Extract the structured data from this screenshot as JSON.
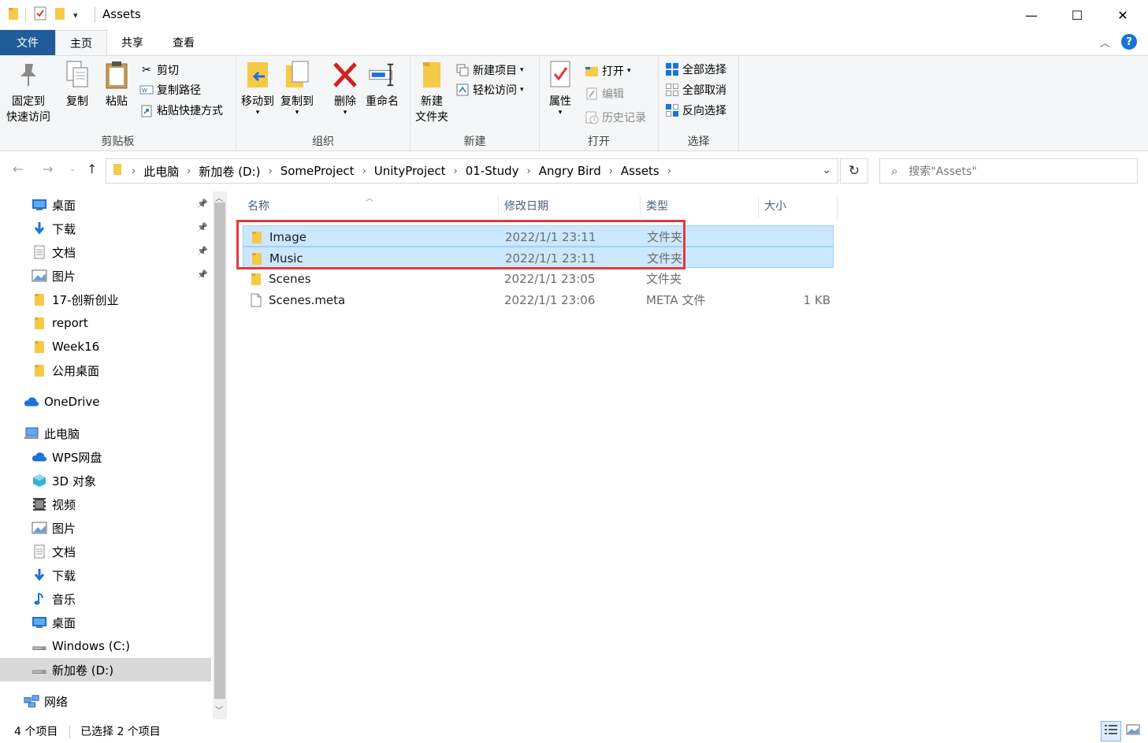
{
  "window": {
    "title": "Assets",
    "minimize_glyph": "—",
    "maximize_glyph": "☐",
    "close_glyph": "✕"
  },
  "tabs": {
    "file": "文件",
    "home": "主页",
    "share": "共享",
    "view": "查看"
  },
  "ribbon": {
    "clipboard": {
      "label": "剪贴板",
      "pin_line1": "固定到",
      "pin_line2": "快速访问",
      "copy": "复制",
      "paste": "粘贴",
      "cut": "剪切",
      "copy_path": "复制路径",
      "paste_shortcut": "粘贴快捷方式"
    },
    "organize": {
      "label": "组织",
      "move_to": "移动到",
      "copy_to": "复制到",
      "delete": "删除",
      "rename": "重命名"
    },
    "new": {
      "label": "新建",
      "new_folder_line1": "新建",
      "new_folder_line2": "文件夹",
      "new_item": "新建项目",
      "easy_access": "轻松访问"
    },
    "open": {
      "label": "打开",
      "properties": "属性",
      "open": "打开",
      "edit": "编辑",
      "history": "历史记录"
    },
    "select": {
      "label": "选择",
      "select_all": "全部选择",
      "select_none": "全部取消",
      "invert": "反向选择"
    }
  },
  "address": {
    "crumbs": [
      "此电脑",
      "新加卷 (D:)",
      "SomeProject",
      "UnityProject",
      "01-Study",
      "Angry Bird",
      "Assets"
    ],
    "search_placeholder": "搜索\"Assets\""
  },
  "sidebar": {
    "items": [
      {
        "label": "桌面",
        "icon": "desktop-icon",
        "pinned": true
      },
      {
        "label": "下载",
        "icon": "download-icon",
        "pinned": true
      },
      {
        "label": "文档",
        "icon": "document-icon",
        "pinned": true
      },
      {
        "label": "图片",
        "icon": "pictures-icon",
        "pinned": true
      },
      {
        "label": "17-创新创业",
        "icon": "folder-icon"
      },
      {
        "label": "report",
        "icon": "folder-icon"
      },
      {
        "label": "Week16",
        "icon": "folder-icon"
      },
      {
        "label": "公用桌面",
        "icon": "folder-icon"
      },
      {
        "label": "OneDrive",
        "icon": "cloud-icon"
      },
      {
        "label": "此电脑",
        "icon": "computer-icon"
      },
      {
        "label": "WPS网盘",
        "icon": "cloud-icon"
      },
      {
        "label": "3D 对象",
        "icon": "cube-icon"
      },
      {
        "label": "视频",
        "icon": "video-icon"
      },
      {
        "label": "图片",
        "icon": "pictures-icon"
      },
      {
        "label": "文档",
        "icon": "document-icon"
      },
      {
        "label": "下载",
        "icon": "download-icon"
      },
      {
        "label": "音乐",
        "icon": "music-icon"
      },
      {
        "label": "桌面",
        "icon": "desktop-icon"
      },
      {
        "label": "Windows (C:)",
        "icon": "drive-icon"
      },
      {
        "label": "新加卷 (D:)",
        "icon": "drive-icon",
        "selected": true
      },
      {
        "label": "网络",
        "icon": "network-icon"
      }
    ]
  },
  "filelist": {
    "columns": {
      "name": "名称",
      "date": "修改日期",
      "type": "类型",
      "size": "大小"
    },
    "rows": [
      {
        "name": "Image",
        "date": "2022/1/1 23:11",
        "type": "文件夹",
        "size": "",
        "selected": true,
        "icon": "folder-icon"
      },
      {
        "name": "Music",
        "date": "2022/1/1 23:11",
        "type": "文件夹",
        "size": "",
        "selected": true,
        "icon": "folder-icon"
      },
      {
        "name": "Scenes",
        "date": "2022/1/1 23:05",
        "type": "文件夹",
        "size": "",
        "selected": false,
        "icon": "folder-icon"
      },
      {
        "name": "Scenes.meta",
        "date": "2022/1/1 23:06",
        "type": "META 文件",
        "size": "1 KB",
        "selected": false,
        "icon": "file-icon"
      }
    ]
  },
  "status": {
    "item_count": "4 个项目",
    "selected_count": "已选择 2 个项目"
  },
  "colors": {
    "file_tab": "#1f5c99",
    "selection_bg": "#cce8ff",
    "highlight_box": "#e03b3b",
    "folder": "#f7c948"
  }
}
